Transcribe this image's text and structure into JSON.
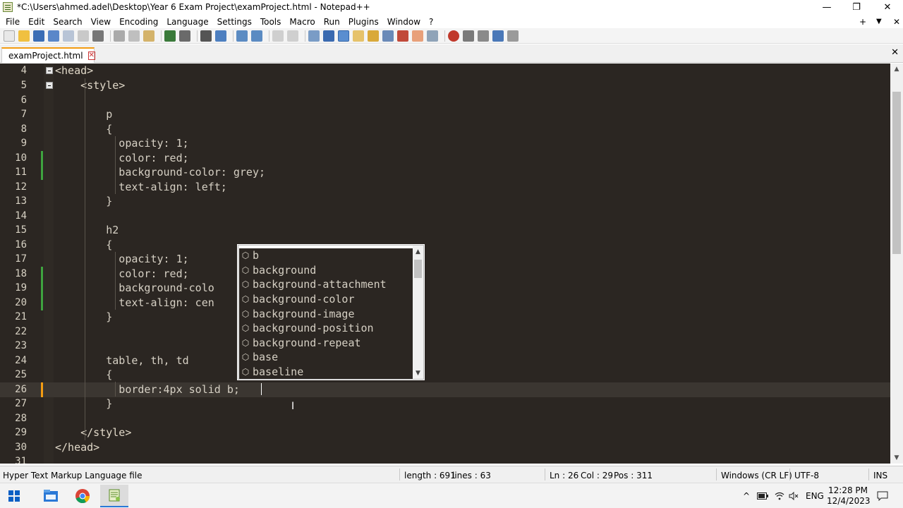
{
  "window": {
    "title": "*C:\\Users\\ahmed.adel\\Desktop\\Year 6 Exam Project\\examProject.html - Notepad++",
    "minimize_glyph": "—",
    "restore_glyph": "❐",
    "close_glyph": "✕"
  },
  "menu": {
    "items": [
      "File",
      "Edit",
      "Search",
      "View",
      "Encoding",
      "Language",
      "Settings",
      "Tools",
      "Macro",
      "Run",
      "Plugins",
      "Window",
      "?"
    ],
    "right_plus": "+",
    "right_down": "▼",
    "right_close": "✕"
  },
  "tab": {
    "label": "examProject.html",
    "close_glyph": "✕",
    "bar_close": "✕"
  },
  "editor": {
    "lines": [
      {
        "num": "4",
        "text": "<head>"
      },
      {
        "num": "5",
        "text": "    <style>"
      },
      {
        "num": "6",
        "text": ""
      },
      {
        "num": "7",
        "text": "        p"
      },
      {
        "num": "8",
        "text": "        {"
      },
      {
        "num": "9",
        "text": "          opacity: 1;"
      },
      {
        "num": "10",
        "text": "          color: red;"
      },
      {
        "num": "11",
        "text": "          background-color: grey;"
      },
      {
        "num": "12",
        "text": "          text-align: left;"
      },
      {
        "num": "13",
        "text": "        }"
      },
      {
        "num": "14",
        "text": ""
      },
      {
        "num": "15",
        "text": "        h2"
      },
      {
        "num": "16",
        "text": "        {"
      },
      {
        "num": "17",
        "text": "          opacity: 1;"
      },
      {
        "num": "18",
        "text": "          color: red;"
      },
      {
        "num": "19",
        "text": "          background-colo"
      },
      {
        "num": "20",
        "text": "          text-align: cen"
      },
      {
        "num": "21",
        "text": "        }"
      },
      {
        "num": "22",
        "text": ""
      },
      {
        "num": "23",
        "text": ""
      },
      {
        "num": "24",
        "text": "        table, th, td"
      },
      {
        "num": "25",
        "text": "        {"
      },
      {
        "num": "26",
        "text": "          border:4px solid b;"
      },
      {
        "num": "27",
        "text": "        }"
      },
      {
        "num": "28",
        "text": ""
      },
      {
        "num": "29",
        "text": "    </style>"
      },
      {
        "num": "30",
        "text": "</head>"
      },
      {
        "num": "31",
        "text": ""
      }
    ]
  },
  "autocomplete": {
    "items": [
      "b",
      "background",
      "background-attachment",
      "background-color",
      "background-image",
      "background-position",
      "background-repeat",
      "base",
      "baseline"
    ],
    "item_icon": "⬡",
    "up_arrow": "▲",
    "down_arrow": "▼"
  },
  "status": {
    "file_type": "Hyper Text Markup Language file",
    "length": "length : 691",
    "lines": "lines : 63",
    "ln": "Ln : 26",
    "col": "Col : 29",
    "pos": "Pos : 311",
    "eol": "Windows (CR LF)",
    "encoding": "UTF-8",
    "mode": "INS"
  },
  "taskbar": {
    "time": "12:28 PM",
    "date": "12/4/2023",
    "lang": "ENG",
    "tray_up": "^"
  },
  "colors": {
    "editor_bg": "#2b2622",
    "change_saved": "#3fa33f",
    "change_unsaved": "#f39c12",
    "tab_accent": "#f39c12"
  }
}
